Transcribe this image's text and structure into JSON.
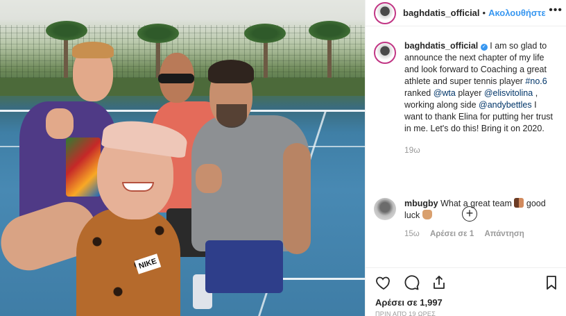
{
  "post": {
    "username": "baghdatis_official",
    "follow_label": "Ακολουθήστε",
    "separator": "•",
    "more_label": "•••"
  },
  "caption": {
    "username": "baghdatis_official",
    "text_1": "I am so glad to announce the next chapter of my life and look forward to Coaching a great athlete and super tennis player ",
    "hashtag": "#no.6",
    "text_2": " ranked ",
    "mention_1": "@wta",
    "text_3": " player ",
    "mention_2": "@elisvitolina",
    "text_4": " , working along side ",
    "mention_3": "@andybettles",
    "text_5": " I want to thank Elina for putting her trust in me. Let's do this! Bring it on 2020.",
    "time": "19ω"
  },
  "load_more_label": "+",
  "comment": {
    "username": "mbugby",
    "text_1": "What a great team ",
    "text_2": " good luck ",
    "time": "15ω",
    "likes": "Αρέσει σε 1",
    "reply": "Απάντηση"
  },
  "stats": {
    "likes": "Αρέσει σε 1,997",
    "date": "ΠΡΙΝ ΑΠΌ 19 ΩΡΕΣ"
  },
  "colors": {
    "link": "#003569",
    "follow": "#3897f0",
    "muted": "#999999"
  },
  "icons": [
    "heart-icon",
    "comment-icon",
    "share-icon",
    "bookmark-icon",
    "plus-circle-icon",
    "verified-icon",
    "more-icon"
  ]
}
